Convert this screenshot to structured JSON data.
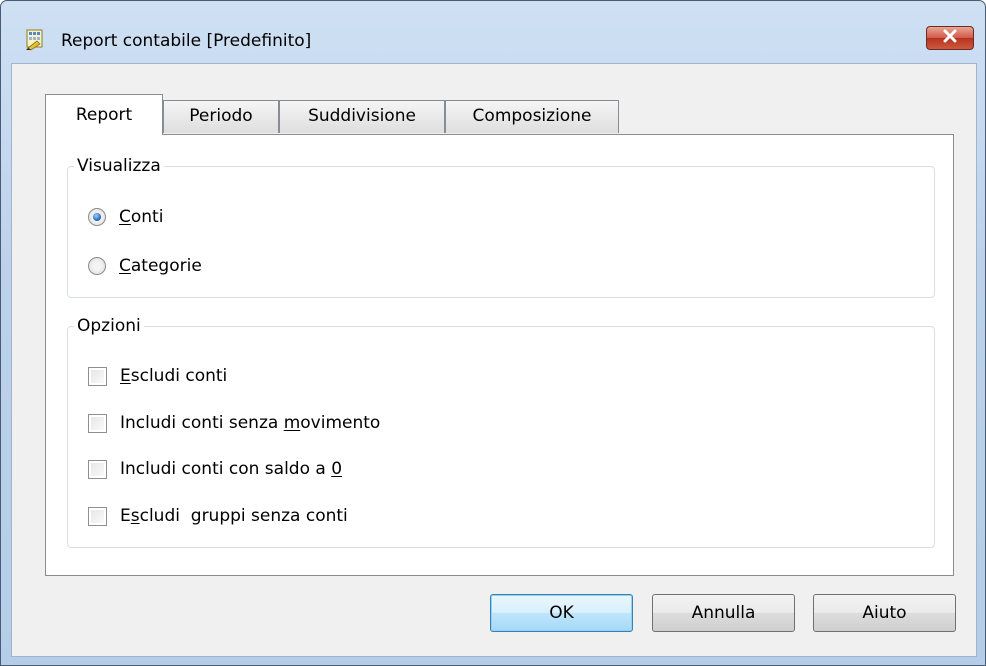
{
  "window": {
    "title": "Report contabile [Predefinito]"
  },
  "tabs": [
    {
      "label": "Report",
      "active": true
    },
    {
      "label": "Periodo",
      "active": false
    },
    {
      "label": "Suddivisione",
      "active": false
    },
    {
      "label": "Composizione",
      "active": false
    }
  ],
  "visualizza": {
    "legend": "Visualizza",
    "options": [
      {
        "mnemonic": "C",
        "rest": "onti",
        "selected": true
      },
      {
        "mnemonic": "C",
        "rest": "ategorie",
        "selected": false
      }
    ]
  },
  "opzioni": {
    "legend": "Opzioni",
    "items": [
      {
        "before": "",
        "mnemonic": "E",
        "after": "scludi conti",
        "checked": false
      },
      {
        "before": "Includi conti senza ",
        "mnemonic": "m",
        "after": "ovimento",
        "checked": false
      },
      {
        "before": "Includi conti con saldo a ",
        "mnemonic": "0",
        "after": "",
        "checked": false
      },
      {
        "before": "E",
        "mnemonic": "s",
        "after": "cludi  gruppi senza conti",
        "checked": false
      }
    ]
  },
  "buttons": {
    "ok": "OK",
    "cancel": "Annulla",
    "help": "Aiuto"
  },
  "icons": {
    "app": "report-sheet-icon",
    "close": "close-icon"
  }
}
